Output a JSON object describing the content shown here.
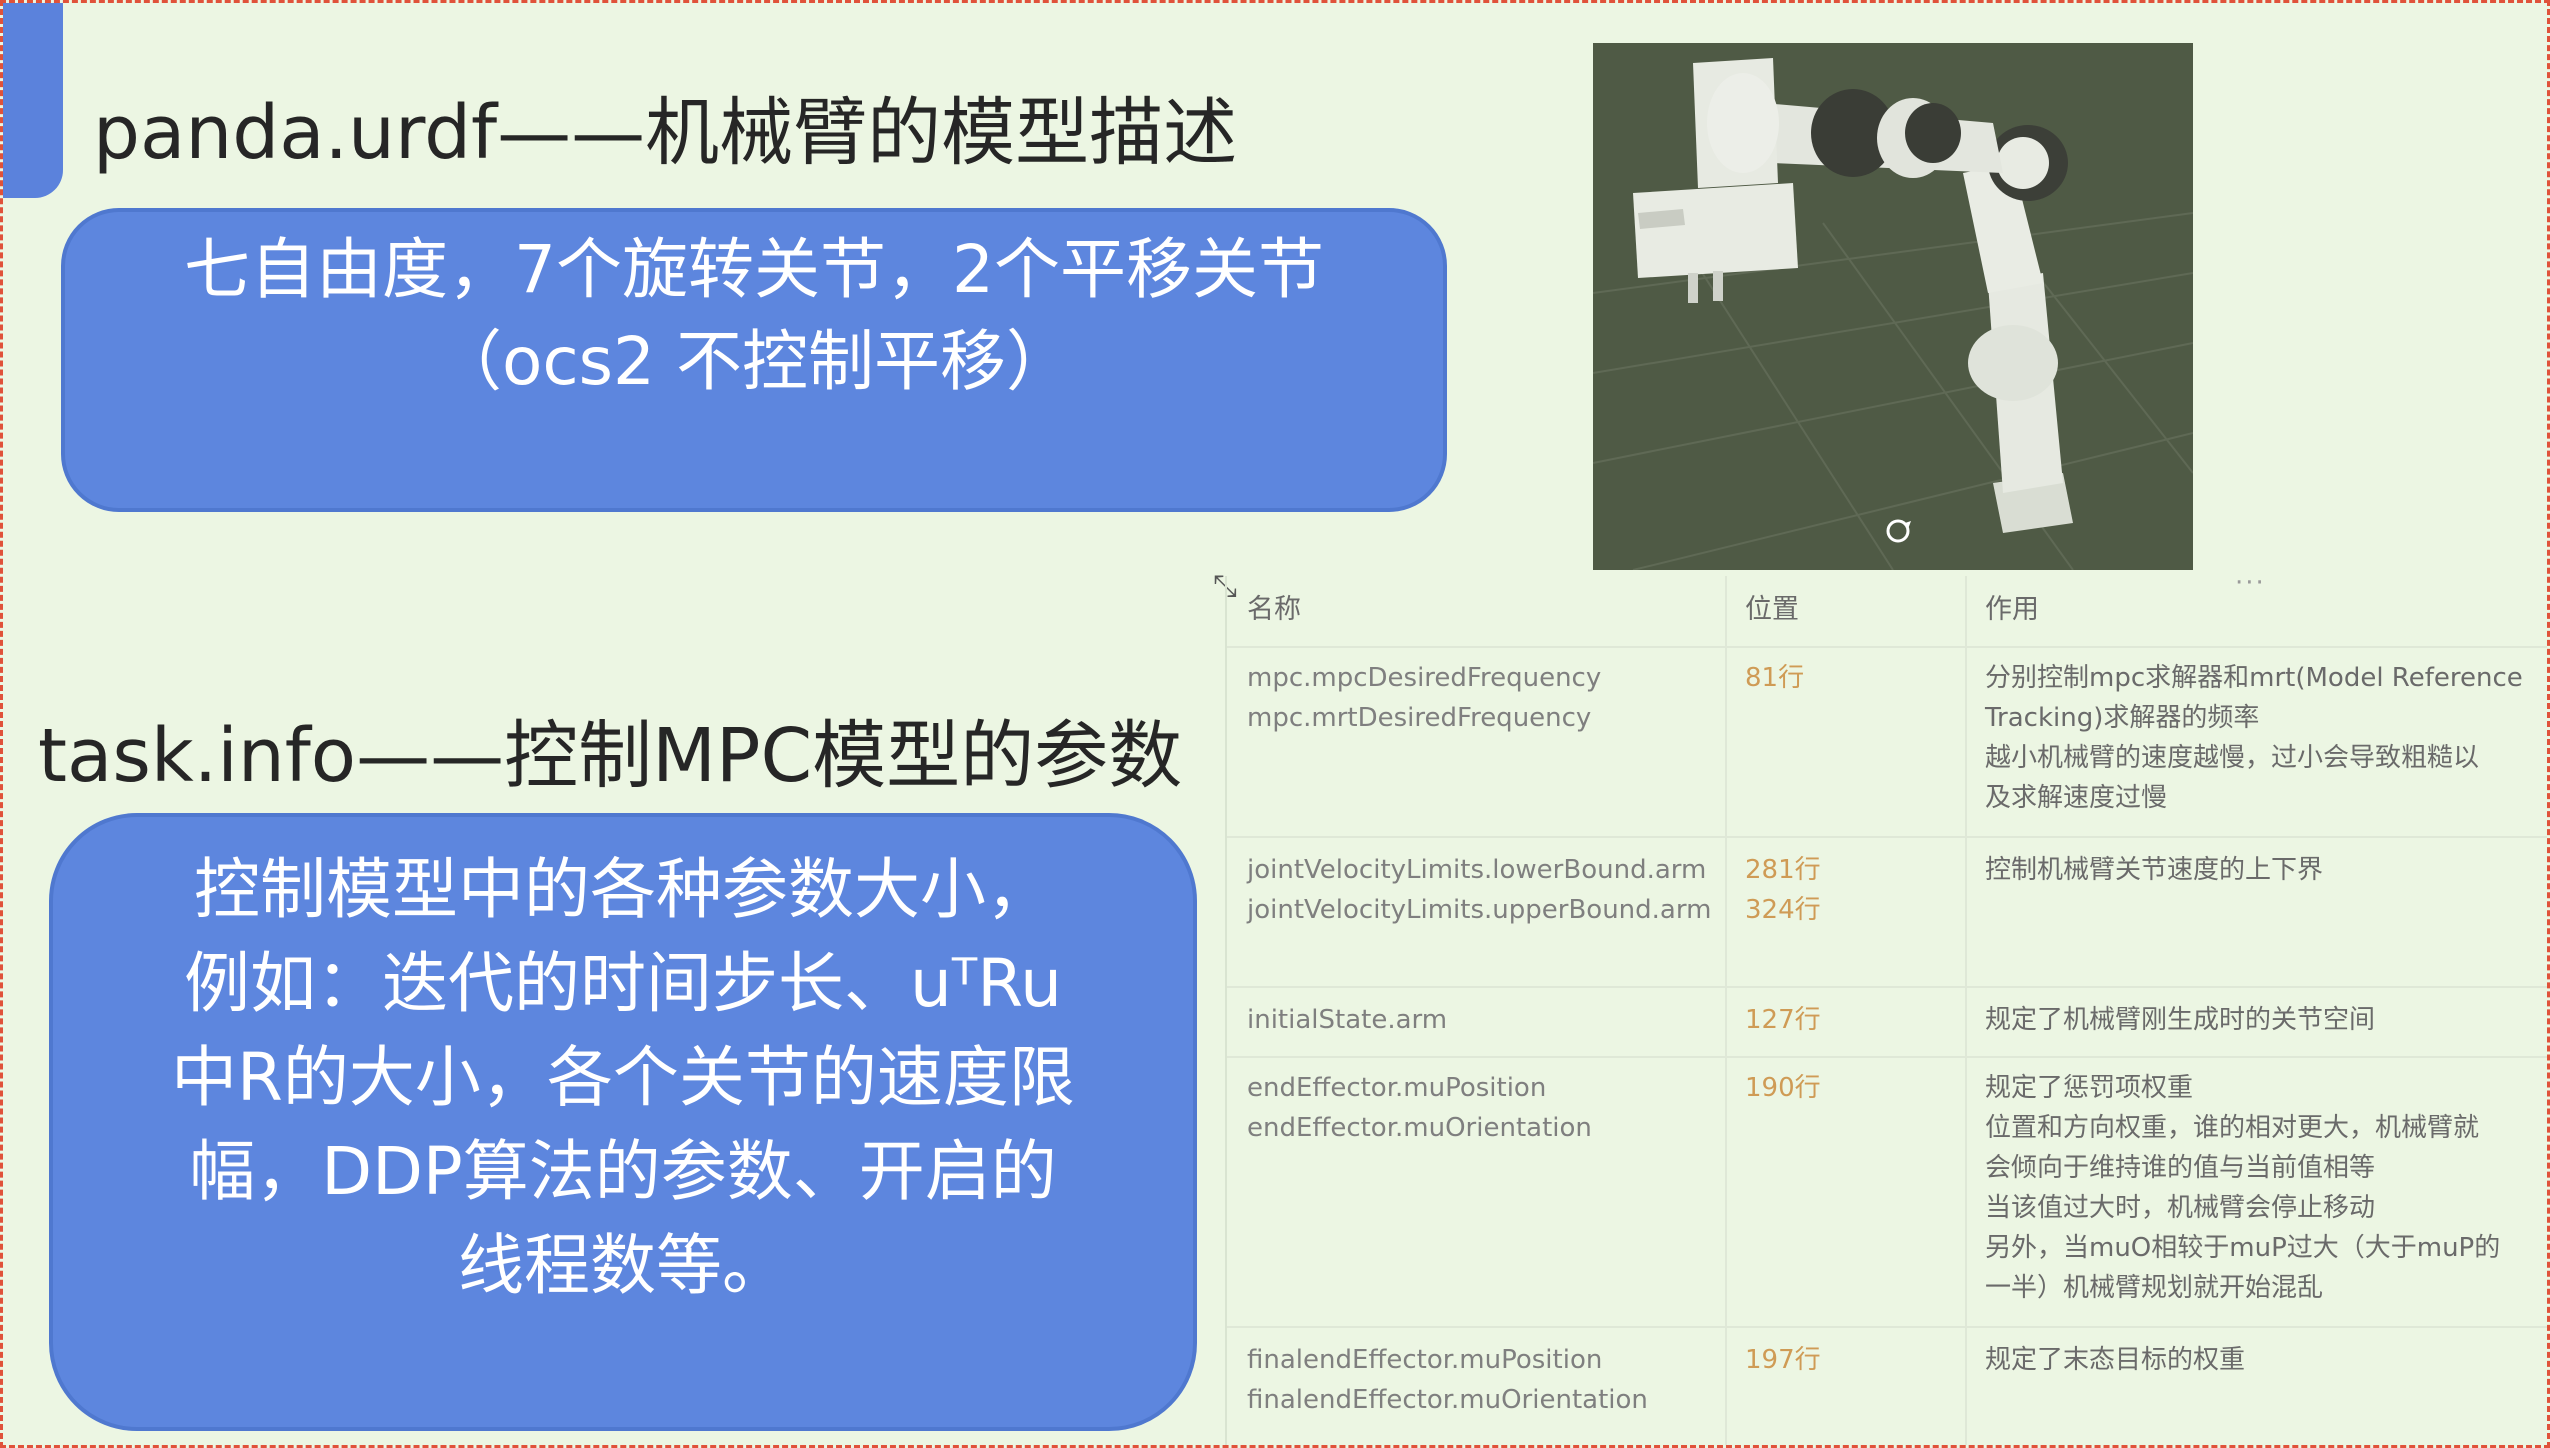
{
  "slide": {
    "heading_1": "panda.urdf——机械臂的模型描述",
    "box_1_lines": [
      "七自由度，7个旋转关节，2个平移关节",
      "（ocs2 不控制平移）"
    ],
    "heading_2": "task.info——控制MPC模型的参数",
    "box_2_lines": [
      "控制模型中的各种参数大小，",
      "例如：迭代的时间步长、uᵀRu",
      "中R的大小，各个关节的速度限",
      "幅，DDP算法的参数、开启的",
      "线程数等。"
    ]
  },
  "icons": {
    "rotate": "rotate-icon",
    "resize": "resize-handle-icon",
    "more": "more-dots-icon"
  },
  "colors": {
    "background": "#ecf6e3",
    "box_blue": "#5d86de",
    "position_text": "#cf9b55",
    "frame_dashed": "#e0523a"
  },
  "table": {
    "headers": [
      "名称",
      "位置",
      "作用"
    ],
    "rows": [
      {
        "name": [
          "mpc.mpcDesiredFrequency",
          "mpc.mrtDesiredFrequency"
        ],
        "position": [
          "81行"
        ],
        "role": [
          "分别控制mpc求解器和mrt(Model Reference",
          "Tracking)求解器的频率",
          "越小机械臂的速度越慢，过小会导致粗糙以",
          "及求解速度过慢"
        ]
      },
      {
        "name": [
          "jointVelocityLimits.lowerBound.arm",
          "jointVelocityLimits.upperBound.arm"
        ],
        "position": [
          "281行",
          "324行"
        ],
        "role": [
          "控制机械臂关节速度的上下界"
        ]
      },
      {
        "name": [
          "initialState.arm"
        ],
        "position": [
          "127行"
        ],
        "role": [
          "规定了机械臂刚生成时的关节空间"
        ]
      },
      {
        "name": [
          "endEffector.muPosition",
          "endEffector.muOrientation"
        ],
        "position": [
          "190行"
        ],
        "role": [
          "规定了惩罚项权重",
          "位置和方向权重，谁的相对更大，机械臂就",
          "会倾向于维持谁的值与当前值相等",
          "当该值过大时，机械臂会停止移动",
          "另外，当muO相较于muP过大（大于muP的",
          "一半）机械臂规划就开始混乱"
        ]
      },
      {
        "name": [
          "finalendEffector.muPosition",
          "finalendEffector.muOrientation"
        ],
        "position": [
          "197行"
        ],
        "role": [
          "规定了末态目标的权重"
        ]
      }
    ]
  }
}
